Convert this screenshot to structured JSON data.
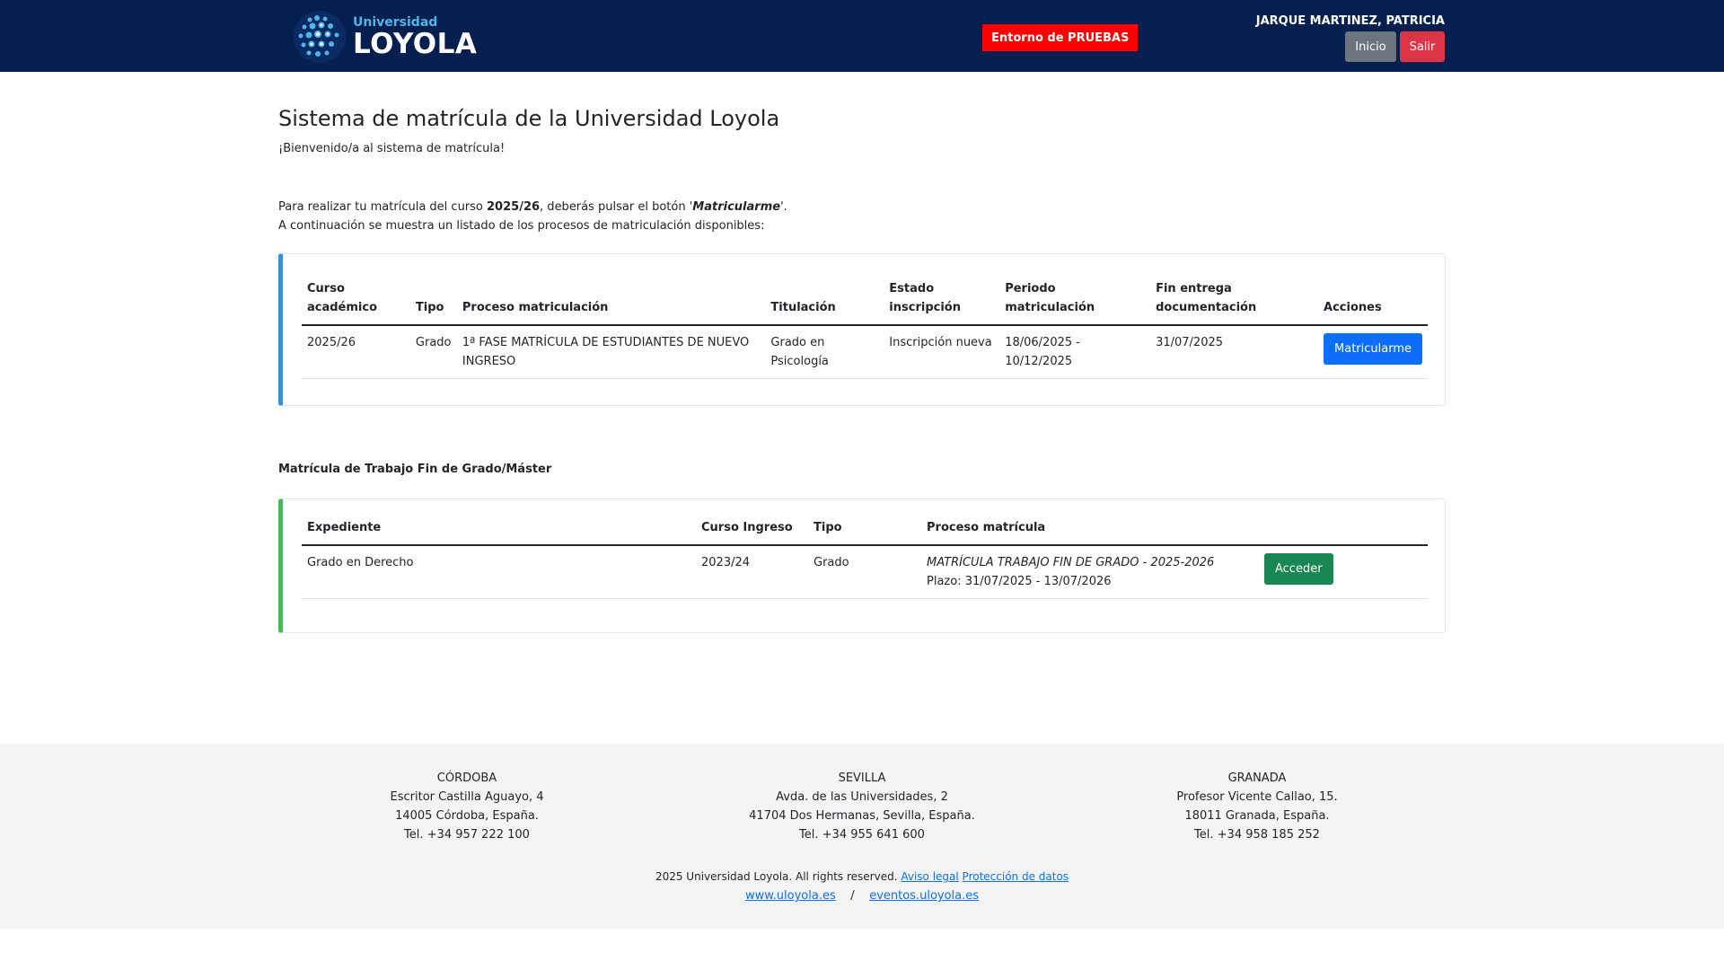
{
  "header": {
    "logo_small": "Universidad",
    "logo_big": "LOYOLA",
    "env_badge": "Entorno de PRUEBAS",
    "user_name": "JARQUE MARTINEZ, PATRICIA",
    "inicio_label": "Inicio",
    "salir_label": "Salir"
  },
  "main": {
    "title": "Sistema de matrícula de la Universidad Loyola",
    "welcome": "¡Bienvenido/a al sistema de matrícula!",
    "intro_1_pre": "Para realizar tu matrícula del curso ",
    "intro_1_year": "2025/26",
    "intro_1_mid": ", deberás pulsar el botón '",
    "intro_1_button": "Matricularme",
    "intro_1_post": "'.",
    "intro_2": "A continuación se muestra un listado de los procesos de matriculación disponibles:"
  },
  "enrollment_table": {
    "headers": {
      "curso": "Curso académico",
      "tipo": "Tipo",
      "proceso": "Proceso matriculación",
      "titulacion": "Titulación",
      "estado": "Estado inscripción",
      "periodo": "Periodo matriculación",
      "fin": "Fin entrega documentación",
      "acciones": "Acciones"
    },
    "rows": [
      {
        "curso": "2025/26",
        "tipo": "Grado",
        "proceso": "1ª FASE MATRÍCULA DE ESTUDIANTES DE NUEVO INGRESO",
        "titulacion": "Grado en Psicología",
        "estado": "Inscripción nueva",
        "periodo": "18/06/2025 - 10/12/2025",
        "fin": "31/07/2025",
        "action_label": "Matricularme"
      }
    ]
  },
  "tfg": {
    "section_title": "Matrícula de Trabajo Fin de Grado/Máster",
    "headers": {
      "expediente": "Expediente",
      "curso_ingreso": "Curso Ingreso",
      "tipo": "Tipo",
      "proceso": "Proceso matrícula"
    },
    "rows": [
      {
        "expediente": "Grado en Derecho",
        "curso_ingreso": "2023/24",
        "tipo": "Grado",
        "proceso": "MATRÍCULA TRABAJO FIN DE GRADO - 2025-2026",
        "plazo": "Plazo: 31/07/2025 - 13/07/2026",
        "action_label": "Acceder"
      }
    ]
  },
  "footer": {
    "offices": [
      {
        "city": "CÓRDOBA",
        "address": "Escritor Castilla Aguayo, 4",
        "postal": "14005 Córdoba, España.",
        "tel": "Tel. +34 957 222 100"
      },
      {
        "city": "SEVILLA",
        "address": "Avda. de las Universidades, 2",
        "postal": "41704 Dos Hermanas, Sevilla, España.",
        "tel": "Tel. +34 955 641 600"
      },
      {
        "city": "GRANADA",
        "address": "Profesor Vicente Callao, 15.",
        "postal": "18011 Granada, España.",
        "tel": "Tel. +34 958 185 252"
      }
    ],
    "copyright": "2025 Universidad Loyola. All rights reserved.",
    "aviso_legal": "Aviso legal",
    "proteccion": "Protección de datos",
    "link_1": "www.uloyola.es",
    "separator": "/",
    "link_2": "eventos.uloyola.es"
  }
}
